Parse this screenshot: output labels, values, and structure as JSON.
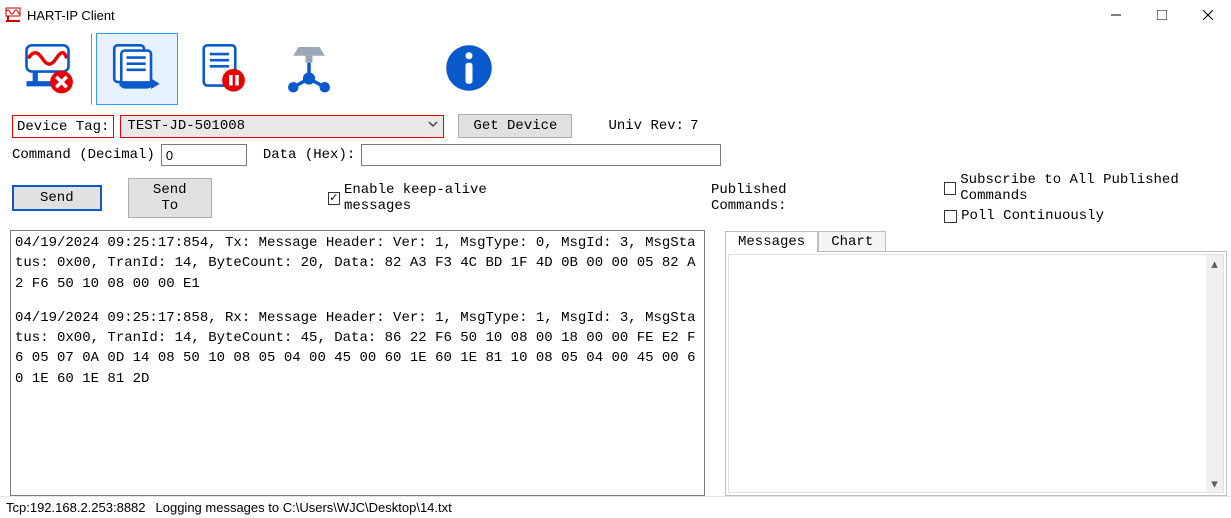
{
  "window": {
    "title": "HART-IP Client"
  },
  "form": {
    "device_tag_label": "Device Tag:",
    "device_tag_value": "TEST-JD-501008",
    "get_device_btn": "Get Device",
    "univ_rev_label": "Univ Rev:",
    "univ_rev_value": "7",
    "command_label": "Command (Decimal)",
    "command_value": "0",
    "data_label": "Data (Hex):",
    "data_value": "",
    "send_btn": "Send",
    "send_to_btn": "Send To",
    "keep_alive_label": "Enable keep-alive messages",
    "keep_alive_checked": true
  },
  "log_entries": [
    "04/19/2024 09:25:17:854, Tx: Message Header: Ver: 1, MsgType: 0, MsgId: 3, MsgStatus: 0x00, TranId: 14, ByteCount: 20, Data: 82 A3 F3 4C BD 1F 4D 0B 00 00 05 82 A2 F6 50 10 08 00 00 E1",
    "04/19/2024 09:25:17:858, Rx: Message Header: Ver: 1, MsgType: 1, MsgId: 3, MsgStatus: 0x00, TranId: 14, ByteCount: 45, Data: 86 22 F6 50 10 08 00 18 00 00 FE E2 F6 05 07 0A 0D 14 08 50 10 08 05 04 00 45 00 60 1E 60 1E 81 10 08 05 04 00 45 00 60 1E 60 1E 81 2D"
  ],
  "right": {
    "published_label": "Published Commands:",
    "subscribe_all_label": "Subscribe to All Published Commands",
    "subscribe_all_checked": false,
    "poll_cont_label": "Poll Continuously",
    "poll_cont_checked": false,
    "tabs": {
      "messages": "Messages",
      "chart": "Chart"
    }
  },
  "status": {
    "tcp": "Tcp:192.168.2.253:8882",
    "logging": "Logging messages to C:\\Users\\WJC\\Desktop\\14.txt"
  },
  "icons": {
    "disconnect": "disconnect-icon",
    "next_doc": "next-doc-icon",
    "pause_doc": "pause-doc-icon",
    "network": "network-icon",
    "info": "info-icon"
  }
}
